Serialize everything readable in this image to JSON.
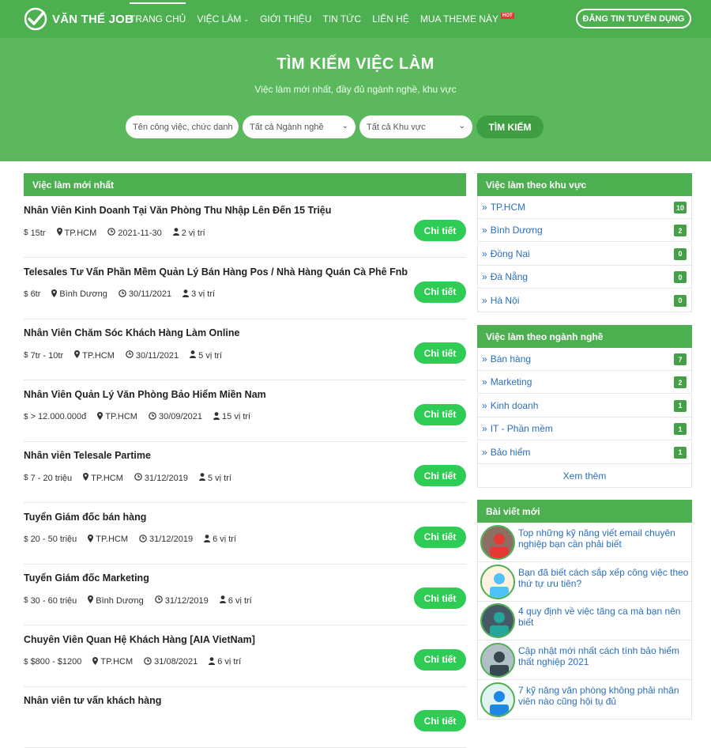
{
  "header": {
    "logo_text": "VĂN THẾ JOB",
    "nav": [
      {
        "label": "TRANG CHỦ",
        "active": true
      },
      {
        "label": "VIỆC LÀM",
        "dropdown": true
      },
      {
        "label": "GIỚI THIỆU"
      },
      {
        "label": "TIN TỨC"
      },
      {
        "label": "LIÊN HỆ"
      },
      {
        "label": "MUA THEME NÀY",
        "badge": "HOT"
      }
    ],
    "post_job_label": "ĐĂNG TIN TUYỂN DỤNG"
  },
  "hero": {
    "title": "TÌM KIẾM VIỆC LÀM",
    "subtitle": "Việc làm mới nhất, đầy đủ ngành nghề, khu vực",
    "keyword_placeholder": "Tên công việc, chức danh",
    "industry_select": "Tất cả Ngành nghề",
    "area_select": "Tất cả Khu vực",
    "search_label": "TÌM KIẾM"
  },
  "latest_jobs": {
    "heading": "Việc làm mới nhất",
    "detail_label": "Chi tiết",
    "items": [
      {
        "title": "Nhân Viên Kinh Doanh Tại Văn Phòng Thu Nhập Lên Đến 15 Triệu",
        "salary": "15tr",
        "location": "TP.HCM",
        "date": "2021-11-30",
        "positions": "2 vị trí"
      },
      {
        "title": "Telesales Tư Vấn Phần Mềm Quản Lý Bán Hàng Pos / Nhà Hàng Quán Cà Phê Fnb",
        "salary": "6tr",
        "location": "Bình Dương",
        "date": "30/11/2021",
        "positions": "3 vị trí"
      },
      {
        "title": "Nhân Viên Chăm Sóc Khách Hàng Làm Online",
        "salary": "7tr - 10tr",
        "location": "TP.HCM",
        "date": "30/11/2021",
        "positions": "5 vị trí"
      },
      {
        "title": "Nhân Viên Quản Lý Văn Phòng Bảo Hiểm Miền Nam",
        "salary": "> 12.000.000đ",
        "location": "TP.HCM",
        "date": "30/09/2021",
        "positions": "15 vị trí"
      },
      {
        "title": "Nhân viên Telesale Partime",
        "salary": "7 - 20 triệu",
        "location": "TP.HCM",
        "date": "31/12/2019",
        "positions": "5 vị trí"
      },
      {
        "title": "Tuyển Giám đốc bán hàng",
        "salary": "20 - 50 triệu",
        "location": "TP.HCM",
        "date": "31/12/2019",
        "positions": "6 vị trí"
      },
      {
        "title": "Tuyển Giám đốc Marketing",
        "salary": "30 - 60 triệu",
        "location": "Bình Dương",
        "date": "31/12/2019",
        "positions": "6 vị trí"
      },
      {
        "title": "Chuyên Viên Quan Hệ Khách Hàng [AIA VietNam]",
        "salary": "$800 - $1200",
        "location": "TP.HCM",
        "date": "31/08/2021",
        "positions": "6 vị trí"
      },
      {
        "title": "Nhân viên tư vấn khách hàng",
        "salary": "",
        "location": "",
        "date": "",
        "positions": ""
      }
    ]
  },
  "by_area": {
    "heading": "Việc làm theo khu vực",
    "items": [
      {
        "label": "TP.HCM",
        "count": "10"
      },
      {
        "label": "Bình Dương",
        "count": "2"
      },
      {
        "label": "Đồng Nai",
        "count": "0"
      },
      {
        "label": "Đà Nẵng",
        "count": "0"
      },
      {
        "label": "Hà Nội",
        "count": "0"
      }
    ]
  },
  "by_industry": {
    "heading": "Việc làm theo ngành nghề",
    "items": [
      {
        "label": "Bán hàng",
        "count": "7"
      },
      {
        "label": "Marketing",
        "count": "2"
      },
      {
        "label": "Kinh doanh",
        "count": "1"
      },
      {
        "label": "IT - Phần mềm",
        "count": "1"
      },
      {
        "label": "Bảo hiểm",
        "count": "1"
      }
    ],
    "more_label": "Xem thêm"
  },
  "recent_posts": {
    "heading": "Bài viết mới",
    "items": [
      {
        "title": "Top những kỹ năng viết email chuyên nghiệp bạn cần phải biết"
      },
      {
        "title": "Bạn đã biết cách sắp xếp công việc theo thứ tự ưu tiên?"
      },
      {
        "title": "4 quy định về việc tăng ca mà bạn nên biết"
      },
      {
        "title": "Cập nhật mới nhất cách tính bảo hiểm thất nghiệp 2021"
      },
      {
        "title": "7 kỹ năng văn phòng không phải nhân viên nào cũng hội tụ đủ"
      }
    ]
  },
  "colors": {
    "header_green": "#4caf50",
    "hero_green": "#5cb85c",
    "button_green": "#2ecc55",
    "link_blue": "#2a6ebb"
  }
}
